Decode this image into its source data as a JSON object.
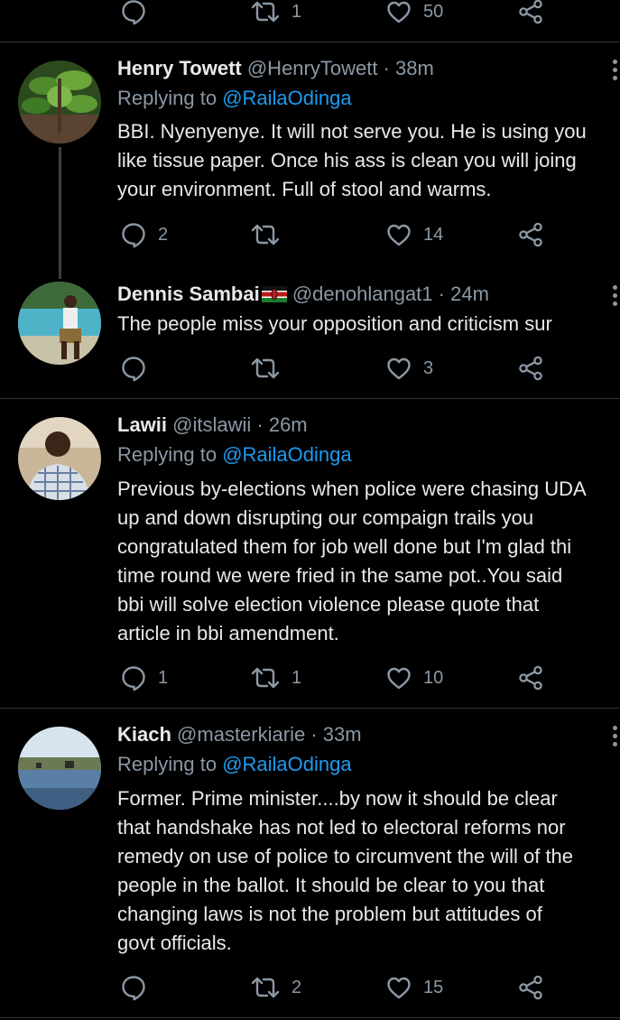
{
  "top_actions": {
    "reply_count": "",
    "retweet_count": "1",
    "like_count": "50"
  },
  "tweets": [
    {
      "name": "Henry Towett",
      "handle": "@HenryTowett",
      "time": "· 38m",
      "replying_to_label": "Replying to",
      "replying_to_handle": "@RailaOdinga",
      "body": "BBI. Nyenyenye. It will not serve you. He is using you\nlike tissue paper. Once his ass is clean you will joing\nyour environment. Full of stool and warms.",
      "reply_count": "2",
      "retweet_count": "",
      "like_count": "14"
    },
    {
      "name": "Dennis Sambai",
      "handle": "@denohlangat1",
      "time": "· 24m",
      "body": "The people miss your opposition and criticism sur",
      "reply_count": "",
      "retweet_count": "",
      "like_count": "3"
    },
    {
      "name": "Lawii",
      "handle": "@itslawii",
      "time": "· 26m",
      "replying_to_label": "Replying to",
      "replying_to_handle": "@RailaOdinga",
      "body": "Previous by-elections when police were chasing UDA\nup and down disrupting our compaign trails you\ncongratulated them for job well done but I'm glad thi\ntime round we were fried in the same pot..You said\nbbi will solve election violence please quote that\narticle in bbi amendment.",
      "reply_count": "1",
      "retweet_count": "1",
      "like_count": "10"
    },
    {
      "name": "Kiach",
      "handle": "@masterkiarie",
      "time": "· 33m",
      "replying_to_label": "Replying to",
      "replying_to_handle": "@RailaOdinga",
      "body": "Former. Prime minister....by now it should be clear\nthat handshake has not led to electoral reforms nor\nremedy on use of police to circumvent the will of the\npeople in the ballot. It should be clear to you that\nchanging laws is not the problem but attitudes of\ngovt officials.",
      "reply_count": "",
      "retweet_count": "2",
      "like_count": "15"
    }
  ],
  "icons": {
    "reply": "reply-icon",
    "retweet": "retweet-icon",
    "like": "heart-icon",
    "share": "share-icon",
    "more": "more-options-icon",
    "flag": "kenya-flag-icon"
  },
  "colors": {
    "background": "#000000",
    "link": "#1d9bf0",
    "muted": "#8b98a5",
    "text": "#e7e9ea",
    "divider": "#2f3336"
  }
}
